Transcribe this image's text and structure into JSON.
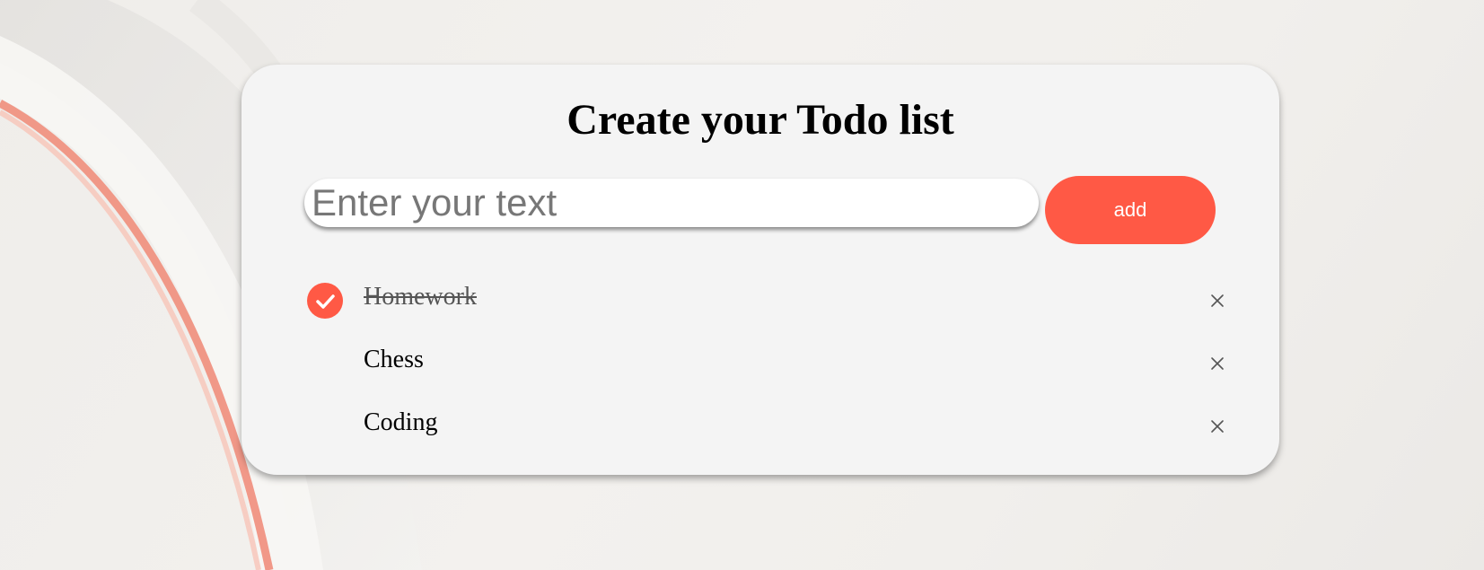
{
  "app": {
    "title": "Create your Todo list"
  },
  "input": {
    "value": "",
    "placeholder": "Enter your text"
  },
  "add_button": {
    "label": "add"
  },
  "todos": [
    {
      "text": "Homework",
      "done": true
    },
    {
      "text": "Chess",
      "done": false
    },
    {
      "text": "Coding",
      "done": false
    }
  ],
  "icons": {
    "check": "check-icon",
    "delete": "close-icon"
  },
  "colors": {
    "accent": "#ff5945",
    "card": "#f4f4f4",
    "done_text": "#555555"
  }
}
